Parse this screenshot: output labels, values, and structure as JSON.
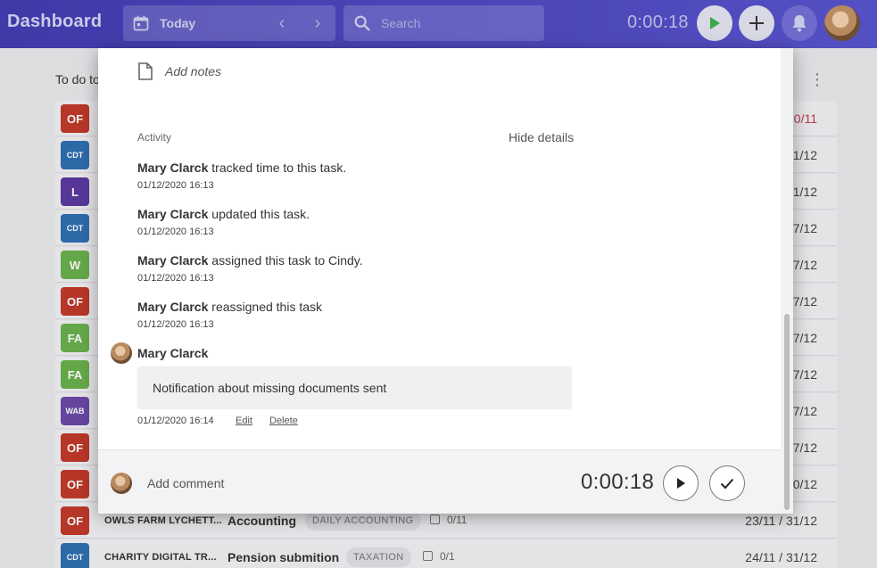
{
  "header": {
    "title": "Dashboard",
    "date_label": "Today",
    "search_placeholder": "Search",
    "timer": "0:00:18",
    "accent": "#4a46b8"
  },
  "background": {
    "section_label": "To do to",
    "rows": [
      {
        "badge": "OF",
        "color": "#c0392b",
        "date": "0/11",
        "red": true
      },
      {
        "badge": "CDT",
        "color": "#2f6fb0",
        "date": "1/12"
      },
      {
        "badge": "L",
        "color": "#5b3aa0",
        "date": "1/12"
      },
      {
        "badge": "CDT",
        "color": "#2f6fb0",
        "date": "7/12"
      },
      {
        "badge": "W",
        "color": "#6ab04c",
        "date": "7/12"
      },
      {
        "badge": "OF",
        "color": "#c0392b",
        "date": "7/12"
      },
      {
        "badge": "FA",
        "color": "#6ab04c",
        "date": "7/12"
      },
      {
        "badge": "FA",
        "color": "#6ab04c",
        "date": "7/12"
      },
      {
        "badge": "WAB",
        "color": "#6a4aa8",
        "date": "7/12"
      },
      {
        "badge": "OF",
        "color": "#c0392b",
        "date": "7/12"
      },
      {
        "badge": "OF",
        "color": "#c0392b",
        "date": "0/12"
      },
      {
        "badge": "OF",
        "color": "#c0392b",
        "client": "OWLS FARM LYCHETT...",
        "name": "Accounting",
        "tag": "DAILY ACCOUNTING",
        "check": "0/11",
        "date": "23/11 / 31/12"
      },
      {
        "badge": "CDT",
        "color": "#2f6fb0",
        "client": "CHARITY DIGITAL TR...",
        "name": "Pension submition",
        "tag": "TAXATION",
        "check": "0/1",
        "date": "24/11 / 31/12"
      }
    ]
  },
  "modal": {
    "notes_label": "Add notes",
    "activity_heading": "Activity",
    "hide_details": "Hide details",
    "activities": [
      {
        "author": "Mary Clarck",
        "text": "tracked time to this task.",
        "time": "01/12/2020 16:13"
      },
      {
        "author": "Mary Clarck",
        "text": "updated this task.",
        "time": "01/12/2020 16:13"
      },
      {
        "author": "Mary Clarck",
        "text": "assigned this task to Cindy.",
        "time": "01/12/2020 16:13"
      },
      {
        "author": "Mary Clarck",
        "text": "reassigned this task",
        "time": "01/12/2020 16:13"
      }
    ],
    "comment": {
      "author": "Mary Clarck",
      "text": "Notification about missing documents sent",
      "time": "01/12/2020 16:14",
      "edit": "Edit",
      "delete": "Delete"
    },
    "footer": {
      "comment_placeholder": "Add comment",
      "timer": "0:00:18"
    }
  }
}
